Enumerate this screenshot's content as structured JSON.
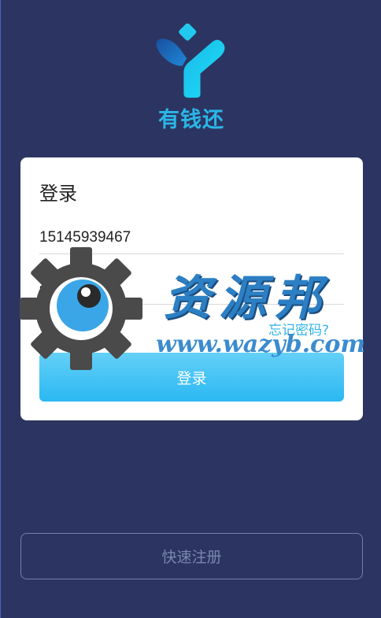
{
  "brand": {
    "name": "有钱还",
    "logo_icon": "y-logo-icon",
    "colors": {
      "logo_dark": "#1565b8",
      "logo_light": "#22d3f0"
    }
  },
  "login_card": {
    "title": "登录",
    "phone_value": "15145939467",
    "password_value": "••••",
    "forgot_label": "忘记密码?",
    "submit_label": "登录"
  },
  "register_label": "快速注册",
  "watermark": {
    "icon": "gear-eye-icon",
    "title": "资源邦",
    "url": "www.wazyb.com"
  },
  "colors": {
    "background": "#2c3561",
    "accent": "#2fb5e6",
    "button": "#2bb8f2"
  }
}
